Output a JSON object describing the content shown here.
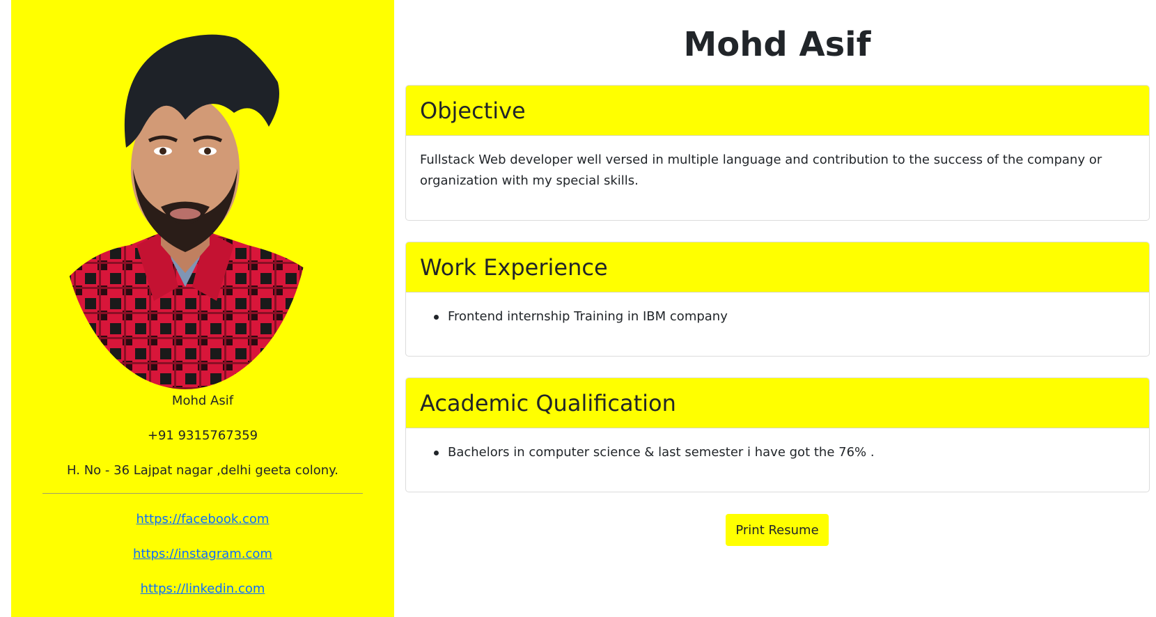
{
  "colors": {
    "accent": "#ffff00",
    "text": "#212529",
    "link": "#0d6efd"
  },
  "sidebar": {
    "photo_alt": "profile-photo",
    "name": "Mohd Asif",
    "phone": "+91 9315767359",
    "address": "H. No - 36 Lajpat nagar ,delhi geeta colony.",
    "links": [
      "https://facebook.com",
      "https://instagram.com",
      "https://linkedin.com"
    ]
  },
  "main": {
    "title": "Mohd Asif",
    "sections": [
      {
        "heading": "Objective",
        "text": "Fullstack Web developer well versed in multiple language and contribution to the success of the company or organization with my special skills."
      },
      {
        "heading": "Work Experience",
        "items": [
          "Frontend internship Training in IBM company"
        ]
      },
      {
        "heading": "Academic Qualification",
        "items": [
          "Bachelors in computer science & last semester i have got the 76% ."
        ]
      }
    ],
    "print_label": "Print Resume"
  }
}
